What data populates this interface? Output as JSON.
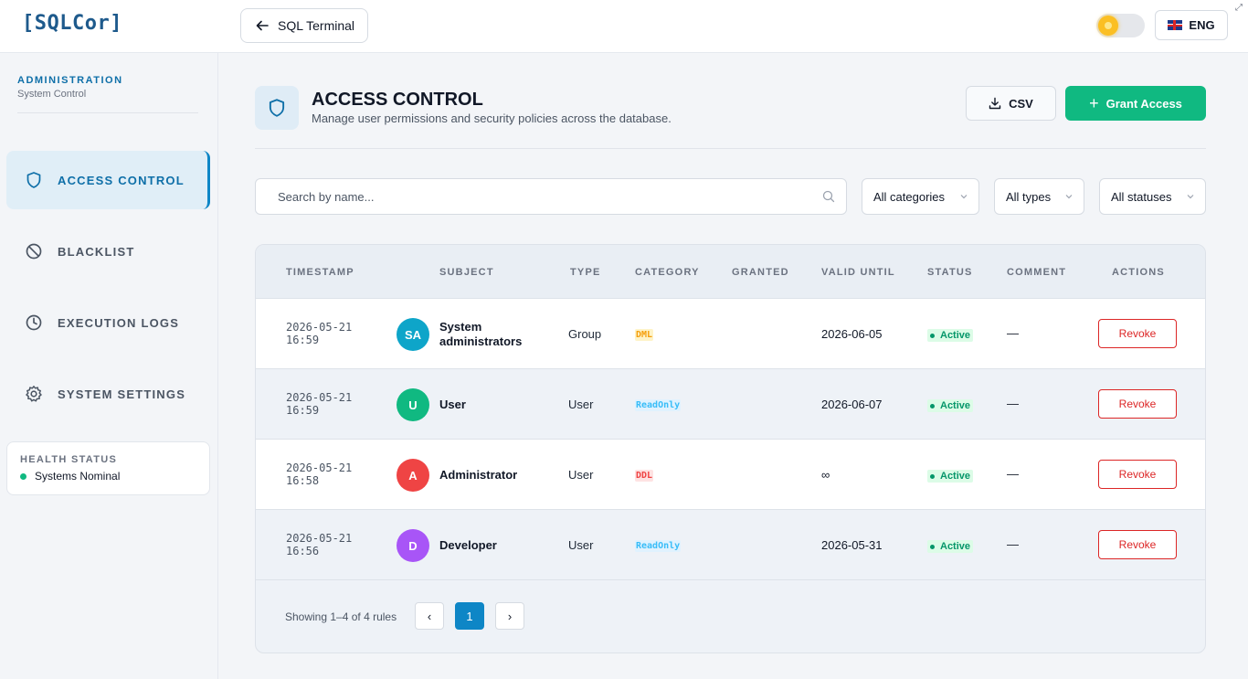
{
  "app": {
    "logo": "[SQLCor]"
  },
  "topbar": {
    "back_label": "SQL Terminal",
    "lang_label": "ENG"
  },
  "sidebar": {
    "title": "ADMINISTRATION",
    "subtitle": "System Control",
    "items": [
      {
        "label": "ACCESS CONTROL",
        "icon": "shield-icon",
        "active": true
      },
      {
        "label": "BLACKLIST",
        "icon": "ban-icon",
        "active": false
      },
      {
        "label": "EXECUTION LOGS",
        "icon": "clock-icon",
        "active": false
      },
      {
        "label": "SYSTEM SETTINGS",
        "icon": "gear-icon",
        "active": false
      }
    ],
    "health": {
      "title": "HEALTH STATUS",
      "status": "Systems Nominal"
    }
  },
  "page": {
    "title": "ACCESS CONTROL",
    "subtitle": "Manage user permissions and security policies across the database.",
    "csv_label": "CSV",
    "grant_label": "Grant Access"
  },
  "filters": {
    "search_placeholder": "Search by name...",
    "category": "All categories",
    "type": "All types",
    "status": "All statuses"
  },
  "table": {
    "columns": [
      "TIMESTAMP",
      "SUBJECT",
      "TYPE",
      "CATEGORY",
      "GRANTED",
      "VALID UNTIL",
      "STATUS",
      "COMMENT",
      "ACTIONS"
    ],
    "rows": [
      {
        "date": "2026-05-21",
        "time": "16:59",
        "initials": "SA",
        "avatar_color": "#0ea5c9",
        "subject_line1": "System",
        "subject_line2": "administrators",
        "type": "Group",
        "category": "DML",
        "category_color": "#f59e0b",
        "category_bg": "#fef3c7",
        "granted": "",
        "valid_until": "2026-06-05",
        "status": "Active",
        "comment": "—",
        "action": "Revoke"
      },
      {
        "date": "2026-05-21",
        "time": "16:59",
        "initials": "U",
        "avatar_color": "#10b981",
        "subject_line1": "User",
        "subject_line2": "",
        "type": "User",
        "category": "ReadOnly",
        "category_color": "#38bdf8",
        "category_bg": "#e0f2fe",
        "granted": "",
        "valid_until": "2026-06-07",
        "status": "Active",
        "comment": "—",
        "action": "Revoke"
      },
      {
        "date": "2026-05-21",
        "time": "16:58",
        "initials": "A",
        "avatar_color": "#ef4444",
        "subject_line1": "Administrator",
        "subject_line2": "",
        "type": "User",
        "category": "DDL",
        "category_color": "#ef4444",
        "category_bg": "#fee2e2",
        "granted": "",
        "valid_until": "∞",
        "status": "Active",
        "comment": "—",
        "action": "Revoke"
      },
      {
        "date": "2026-05-21",
        "time": "16:56",
        "initials": "D",
        "avatar_color": "#a855f7",
        "subject_line1": "Developer",
        "subject_line2": "",
        "type": "User",
        "category": "ReadOnly",
        "category_color": "#38bdf8",
        "category_bg": "#e0f2fe",
        "granted": "",
        "valid_until": "2026-05-31",
        "status": "Active",
        "comment": "—",
        "action": "Revoke"
      }
    ],
    "footer": {
      "showing": "Showing 1–4 of 4 rules",
      "prev": "‹",
      "page": "1",
      "next": "›"
    }
  },
  "colors": {
    "accent": "#0e86c6",
    "success": "#10b981",
    "danger": "#dc2626",
    "brand": "#1e5a8c"
  }
}
